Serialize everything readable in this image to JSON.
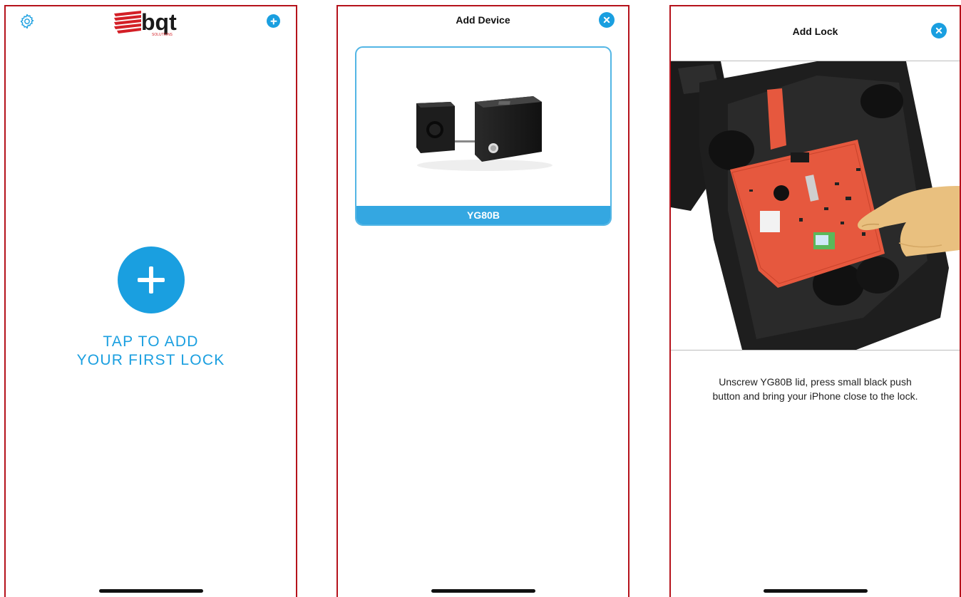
{
  "screen_home": {
    "settings_icon": "gear-icon",
    "logo_text": "bqt",
    "logo_subtext": "SOLUTIONS",
    "add_icon": "plus-circle-icon",
    "cta_line1": "TAP TO ADD",
    "cta_line2": "YOUR FIRST LOCK"
  },
  "screen_add_device": {
    "title": "Add Device",
    "close_icon": "close-circle-icon",
    "devices": [
      {
        "name": "YG80B"
      }
    ]
  },
  "screen_add_lock": {
    "title": "Add Lock",
    "close_icon": "close-circle-icon",
    "instruction_line1": "Unscrew YG80B lid, press small black push",
    "instruction_line2": "button and bring your iPhone close to the lock."
  },
  "colors": {
    "accent": "#1a9fe0",
    "card_border": "#53b6e5",
    "frame_border": "#b5121b",
    "logo_red": "#d31f26"
  }
}
